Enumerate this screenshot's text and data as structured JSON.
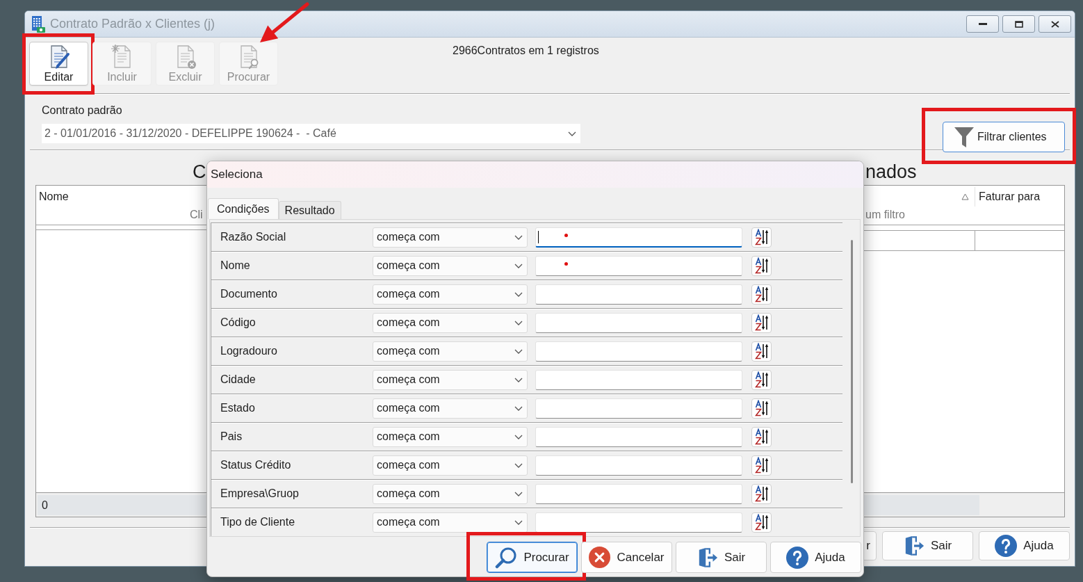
{
  "window": {
    "title": "Contrato Padrão x Clientes (j)",
    "active": false
  },
  "toolbar": {
    "buttons": [
      {
        "label": "Editar",
        "kind": "edit",
        "disabled": false,
        "highlighted": true,
        "arrow": false
      },
      {
        "label": "Incluir",
        "kind": "new",
        "disabled": true,
        "highlighted": false,
        "arrow": false
      },
      {
        "label": "Excluir",
        "kind": "delete",
        "disabled": true,
        "highlighted": false,
        "arrow": false
      },
      {
        "label": "Procurar",
        "kind": "search",
        "disabled": true,
        "highlighted": false,
        "arrow": true
      }
    ],
    "status": "2966Contratos em 1 registros"
  },
  "contract": {
    "label": "Contrato padrão",
    "value": "2 - 01/01/2016 - 31/12/2020 - DEFELIPPE 190624 -  - Café"
  },
  "filter_button": {
    "label": "Filtrar clientes",
    "highlighted": true
  },
  "left_grid": {
    "heading": "C",
    "columns": [
      "Nome"
    ],
    "filter_hint": "Cli",
    "footer": "0"
  },
  "right_grid": {
    "heading": "nados",
    "sorted": true,
    "columns": [
      "Faturar para"
    ],
    "filter_hint": "um filtro"
  },
  "footer_buttons": [
    {
      "label": "r",
      "kind": "text"
    },
    {
      "label": "Sair",
      "kind": "exit"
    },
    {
      "label": "Ajuda",
      "kind": "help"
    }
  ],
  "dialog": {
    "title": "Seleciona",
    "tabs": [
      {
        "label": "Condições",
        "selected": true
      },
      {
        "label": "Resultado",
        "selected": false
      }
    ],
    "conditions": [
      {
        "field": "Razão Social",
        "operator": "começa com",
        "focused": true,
        "marked": true
      },
      {
        "field": "Nome",
        "operator": "começa com",
        "focused": false,
        "marked": true
      },
      {
        "field": "Documento",
        "operator": "começa com",
        "focused": false,
        "marked": false
      },
      {
        "field": "Código",
        "operator": "começa com",
        "focused": false,
        "marked": false
      },
      {
        "field": "Logradouro",
        "operator": "começa com",
        "focused": false,
        "marked": false
      },
      {
        "field": "Cidade",
        "operator": "começa com",
        "focused": false,
        "marked": false
      },
      {
        "field": "Estado",
        "operator": "começa com",
        "focused": false,
        "marked": false
      },
      {
        "field": "Pais",
        "operator": "começa com",
        "focused": false,
        "marked": false
      },
      {
        "field": "Status Crédito",
        "operator": "começa com",
        "focused": false,
        "marked": false
      },
      {
        "field": "Empresa\\Gruop",
        "operator": "começa com",
        "focused": false,
        "marked": false
      },
      {
        "field": "Tipo de Cliente",
        "operator": "começa com",
        "focused": false,
        "marked": false
      }
    ],
    "buttons": [
      {
        "label": "Procurar",
        "kind": "search",
        "default": true,
        "highlighted": true
      },
      {
        "label": "Cancelar",
        "kind": "cancel",
        "default": false,
        "highlighted": false
      },
      {
        "label": "Sair",
        "kind": "exit",
        "default": false,
        "highlighted": false
      },
      {
        "label": "Ajuda",
        "kind": "help",
        "default": false,
        "highlighted": false
      }
    ]
  }
}
